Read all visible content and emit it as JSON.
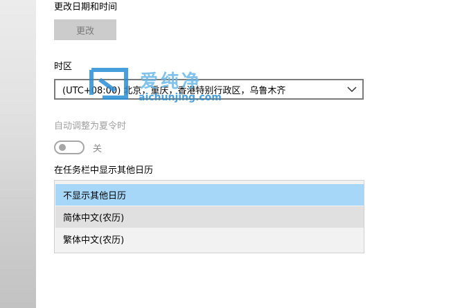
{
  "date_time": {
    "change_label": "更改日期和时间",
    "change_button": "更改"
  },
  "timezone": {
    "label": "时区",
    "selected": "(UTC+08:00) 北京，重庆，香港特别行政区，乌鲁木齐"
  },
  "dst": {
    "label": "自动调整为夏令时",
    "toggle_state": "关"
  },
  "calendar": {
    "label": "在任务栏中显示其他日历",
    "options": [
      "不显示其他日历",
      "简体中文(农历)",
      "繁体中文(农历)"
    ]
  },
  "watermark": {
    "chinese": "爱纯净",
    "domain": "aichunjing.com"
  },
  "colors": {
    "selected_option": "#a6d7f8",
    "hover_option": "#e0e0e0",
    "watermark_blue": "#2a8fd6"
  }
}
